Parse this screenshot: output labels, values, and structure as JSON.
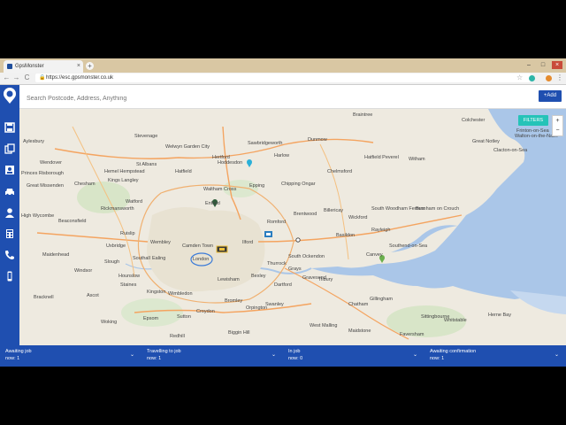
{
  "browser": {
    "tab_title": "GpsMonster",
    "tab_close": "×",
    "new_tab": "+",
    "url": "https://esc.gpsmonster.co.uk",
    "window_controls": [
      "–",
      "□",
      "×"
    ],
    "nav": [
      "←",
      "→",
      "C"
    ]
  },
  "search": {
    "placeholder": "Search Postcode, Address, Anything",
    "add_label": "+Add"
  },
  "sidebar": {
    "icons": [
      "save-icon",
      "copy-icon",
      "contact-card-icon",
      "car-icon",
      "user-icon",
      "calculator-icon",
      "phone-icon",
      "mobile-icon"
    ]
  },
  "map": {
    "filters_label": "FILTERS",
    "zoom_in": "+",
    "zoom_out": "−",
    "places": [
      "Braintree",
      "Dunmow",
      "Aylesbury",
      "Stevenage",
      "Welwyn Garden City",
      "Sawbridgeworth",
      "Harlow",
      "Great Notley",
      "Chelmsford",
      "Witham",
      "St Albans",
      "Hertford",
      "Hoddesdon",
      "Wendover",
      "Princes Risborough",
      "Great Missenden",
      "Chesham",
      "Kings Langley",
      "Hemel Hempstead",
      "Watford",
      "Hatfield",
      "Epping",
      "Chipping Ongar",
      "Waltham Cross",
      "Enfield",
      "Brentwood",
      "Billericay",
      "Wickford",
      "South Woodham Ferrers",
      "Burnham on Crouch",
      "High Wycombe",
      "Beaconsfield",
      "Rickmansworth",
      "Ruislip",
      "Uxbridge",
      "Wembley",
      "Camden Town",
      "London",
      "Ilford",
      "Romford",
      "Basildon",
      "Rayleigh",
      "Southend-on-Sea",
      "Canvey",
      "Maidenhead",
      "Windsor",
      "Slough",
      "Southall",
      "Ealing",
      "Bracknell",
      "Ascot",
      "Staines",
      "Hounslow",
      "Kingston",
      "Wimbledon",
      "Lewisham",
      "Bexley",
      "Dartford",
      "Gravesend",
      "Chatham",
      "Gillingham",
      "Sittingbourne",
      "Woking",
      "Epsom",
      "Croydon",
      "Bromley",
      "Orpington",
      "Swanley",
      "Maidstone",
      "Sutton",
      "Redhill",
      "Biggin Hill",
      "West Malling",
      "Clacton-on-Sea",
      "Herne Bay",
      "Whitstable",
      "Faversham",
      "Tilbury",
      "Grays",
      "South Ockendon",
      "Thurrock",
      "Walton-on-the-Naze",
      "Frinton-on-Sea",
      "Colchester",
      "Hatfield Peverel"
    ]
  },
  "status": [
    {
      "label": "Awaiting job",
      "count": "now: 1"
    },
    {
      "label": "Travelling to job",
      "count": "now: 1"
    },
    {
      "label": "In job",
      "count": "now: 0"
    },
    {
      "label": "Awaiting confirmation",
      "count": "now: 1"
    }
  ],
  "colors": {
    "brand": "#1f4fb0",
    "filters": "#25c3b8",
    "sea": "#aac6e8",
    "land": "#eeeae0"
  }
}
